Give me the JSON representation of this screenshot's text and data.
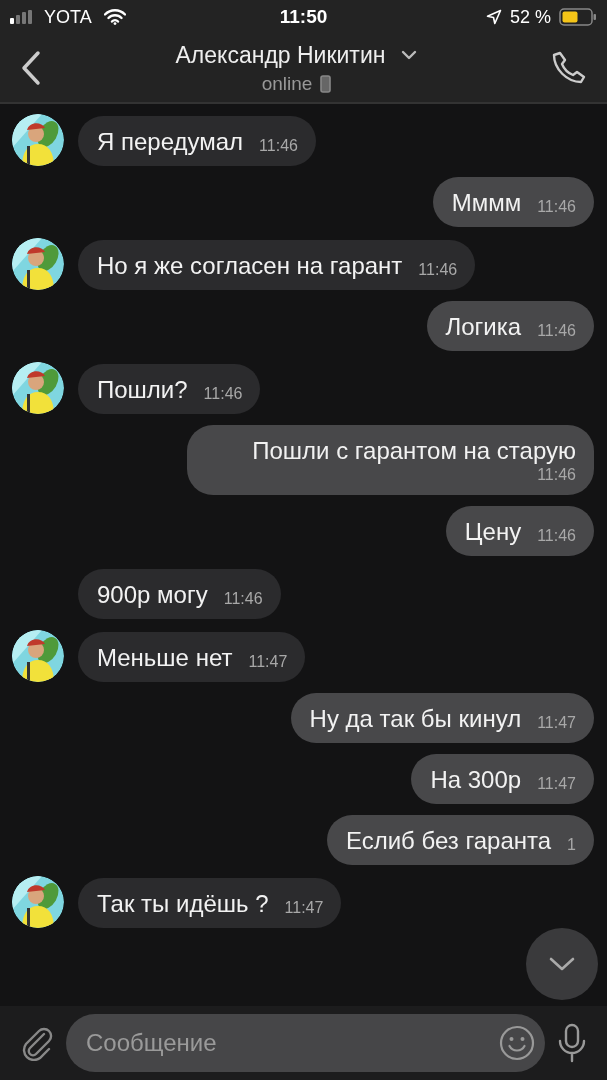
{
  "status_bar": {
    "carrier": "YOTA",
    "time": "11:50",
    "battery": "52 %"
  },
  "header": {
    "title": "Александр Никитин",
    "status": "online"
  },
  "messages": [
    {
      "kind": "incoming",
      "avatar": true,
      "text": "Я передумал",
      "time": "11:46"
    },
    {
      "kind": "outgoing",
      "text": "Мммм",
      "time": "11:46"
    },
    {
      "kind": "incoming",
      "avatar": true,
      "text": "Но я же согласен на гарант",
      "time": "11:46"
    },
    {
      "kind": "outgoing",
      "text": "Логика",
      "time": "11:46"
    },
    {
      "kind": "incoming",
      "avatar": true,
      "text": "Пошли?",
      "time": "11:46"
    },
    {
      "kind": "outgoing",
      "text": "Пошли с гарантом на старую",
      "time": "11:46"
    },
    {
      "kind": "outgoing",
      "text": "Цену",
      "time": "11:46"
    },
    {
      "kind": "incoming",
      "avatar": false,
      "text": "900р могу",
      "time": "11:46"
    },
    {
      "kind": "incoming",
      "avatar": true,
      "text": "Меньше нет",
      "time": "11:47"
    },
    {
      "kind": "outgoing",
      "text": "Ну да так бы кинул",
      "time": "11:47"
    },
    {
      "kind": "outgoing",
      "text": "На 300р",
      "time": "11:47"
    },
    {
      "kind": "outgoing",
      "text": "Еслиб без гаранта",
      "time": "1"
    },
    {
      "kind": "incoming",
      "avatar": true,
      "text": "Так ты идёшь ?",
      "time": "11:47"
    }
  ],
  "composer": {
    "placeholder": "Сообщение"
  }
}
